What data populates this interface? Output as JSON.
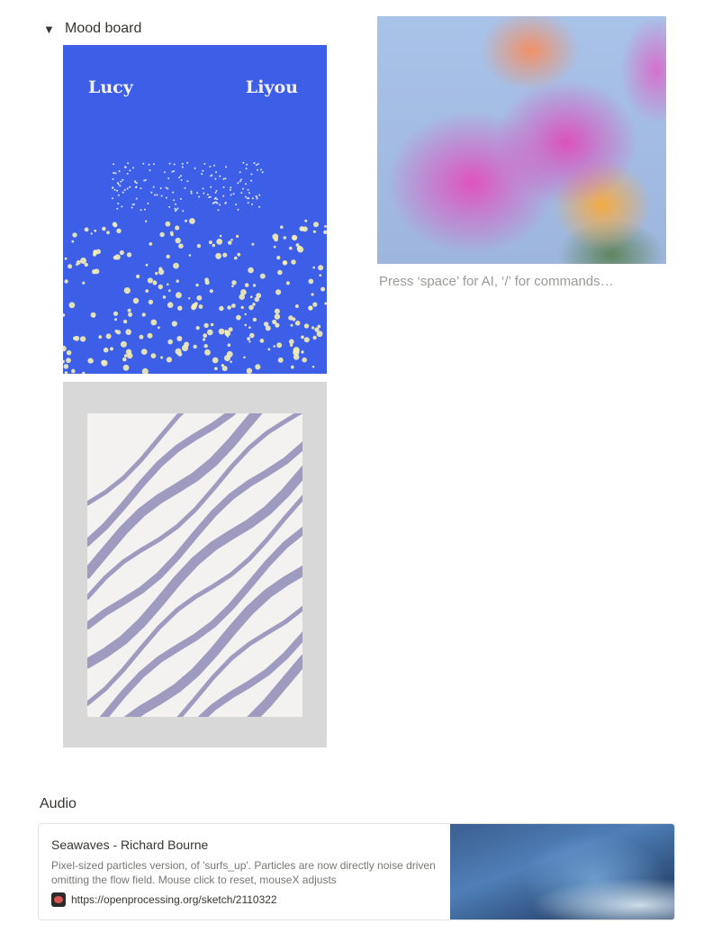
{
  "moodboard": {
    "toggle_icon": "triangle-down-icon",
    "title": "Mood board",
    "poster_left_text": "Lucy",
    "poster_right_text": "Liyou"
  },
  "editor": {
    "placeholder": "Press ‘space’ for AI, ‘/’ for commands…"
  },
  "audio": {
    "heading": "Audio",
    "bookmark": {
      "title": "Seawaves - Richard Bourne",
      "description": "Pixel-sized particles version, of 'surfs_up'. Particles are now directly noise driven omitting the flow field. Mouse click to reset, mouseX adjusts",
      "url": "https://openprocessing.org/sketch/2110322",
      "favicon": "openprocessing-favicon-icon"
    }
  }
}
